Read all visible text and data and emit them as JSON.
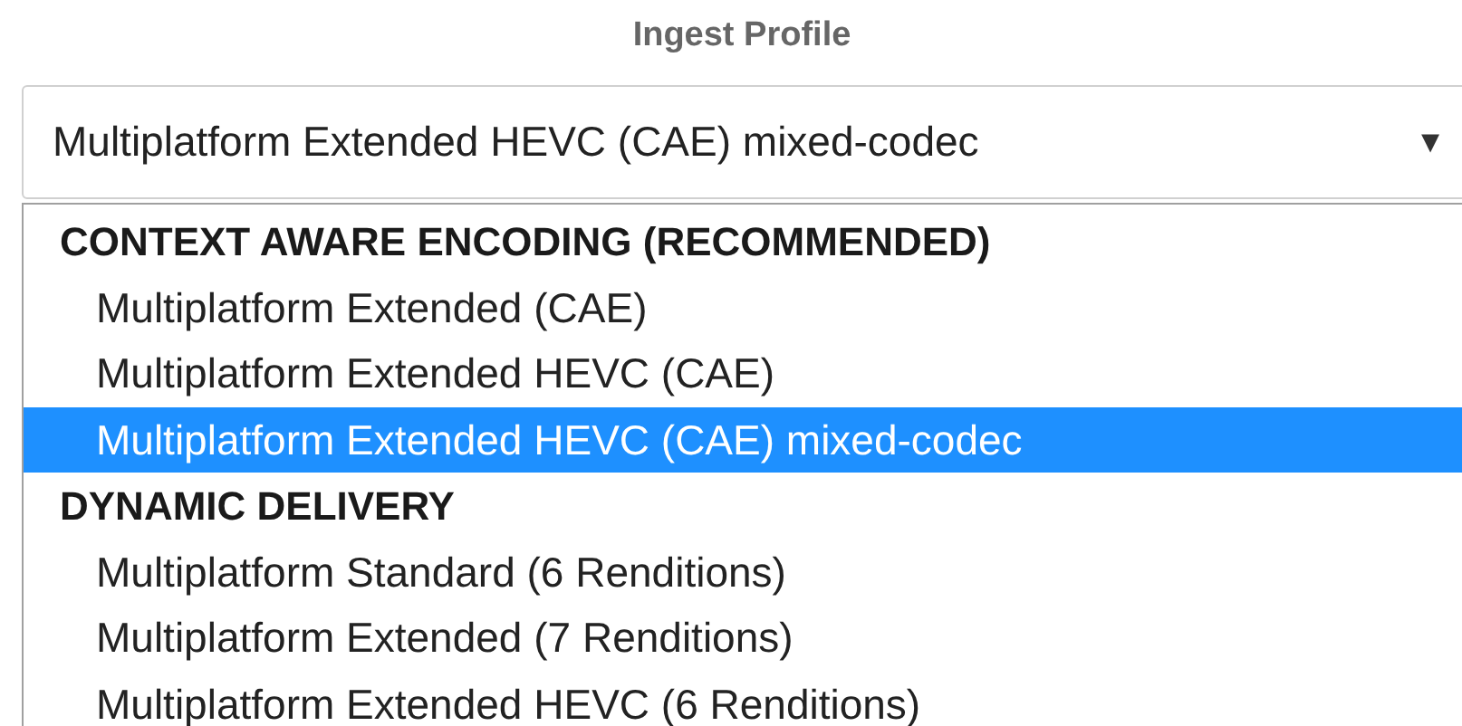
{
  "label": "Ingest Profile",
  "select": {
    "value": "Multiplatform Extended HEVC (CAE) mixed-codec",
    "arrow": "▼"
  },
  "groups": [
    {
      "header": "CONTEXT AWARE ENCODING (RECOMMENDED)",
      "options": [
        {
          "label": "Multiplatform Extended (CAE)",
          "selected": false
        },
        {
          "label": "Multiplatform Extended HEVC (CAE)",
          "selected": false
        },
        {
          "label": "Multiplatform Extended HEVC (CAE) mixed-codec",
          "selected": true
        }
      ]
    },
    {
      "header": "DYNAMIC DELIVERY",
      "options": [
        {
          "label": "Multiplatform Standard (6 Renditions)",
          "selected": false
        },
        {
          "label": "Multiplatform Extended (7 Renditions)",
          "selected": false
        },
        {
          "label": "Multiplatform Extended HEVC (6 Renditions)",
          "selected": false
        }
      ]
    }
  ]
}
